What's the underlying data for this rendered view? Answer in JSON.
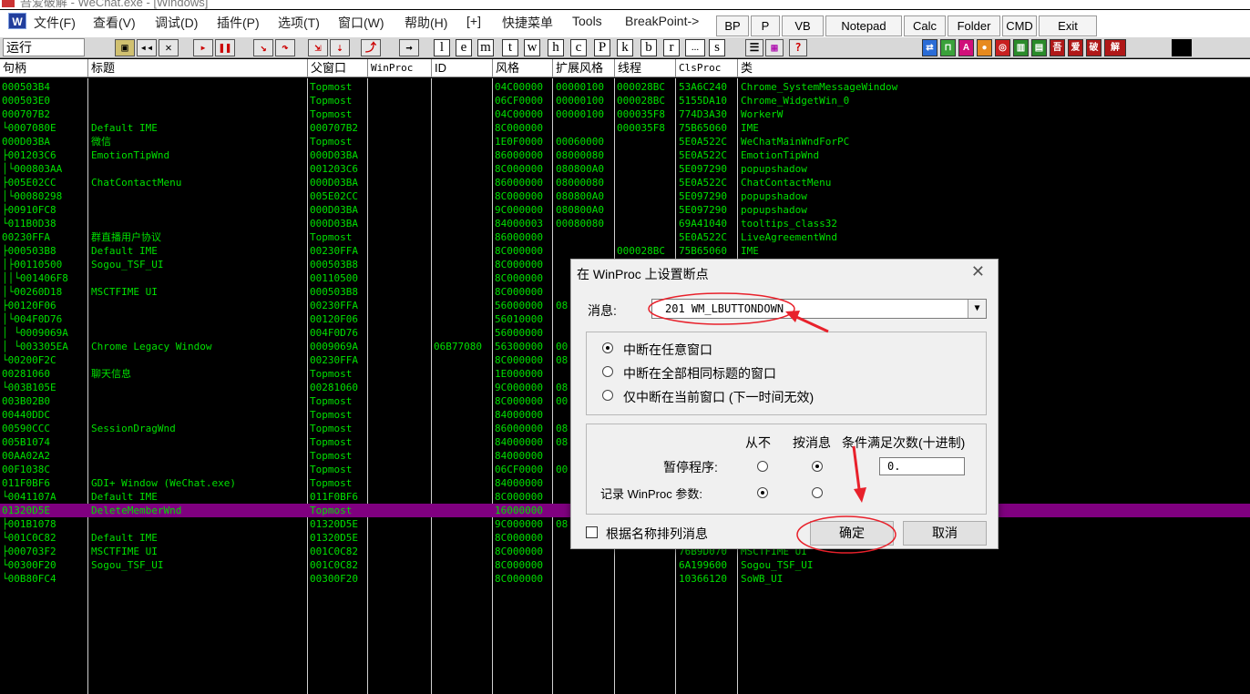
{
  "window": {
    "title": "吾爱破解 - WeChat.exe - [Windows]"
  },
  "menu": [
    "文件(F)",
    "查看(V)",
    "调试(D)",
    "插件(P)",
    "选项(T)",
    "窗口(W)",
    "帮助(H)",
    "[+]",
    "快捷菜单",
    "Tools",
    "BreakPoint->"
  ],
  "quick_buttons": [
    "BP",
    "P",
    "VB",
    "Notepad",
    "Calc",
    "Folder",
    "CMD",
    "Exit"
  ],
  "toolbar": {
    "status": "运行",
    "letters": [
      "l",
      "e",
      "m",
      "t",
      "w",
      "h",
      "c",
      "P",
      "k",
      "b",
      "r",
      "...",
      "s"
    ],
    "right_buttons": [
      "解",
      "破",
      "爱",
      "吾"
    ]
  },
  "columns": [
    "句柄",
    "标题",
    "父窗口",
    "WinProc",
    "ID",
    "风格",
    "扩展风格",
    "线程",
    "ClsProc",
    "类"
  ],
  "rows": [
    [
      "000503B4",
      "",
      "Topmost",
      "",
      "",
      "04C00000",
      "00000100",
      "000028BC",
      "53A6C240",
      "Chrome_SystemMessageWindow"
    ],
    [
      "000503E0",
      "",
      "Topmost",
      "",
      "",
      "06CF0000",
      "00000100",
      "000028BC",
      "5155DA10",
      "Chrome_WidgetWin_0"
    ],
    [
      "000707B2",
      "",
      "Topmost",
      "",
      "",
      "04C00000",
      "00000100",
      "000035F8",
      "774D3A30",
      "WorkerW"
    ],
    [
      "└0007080E",
      "Default IME",
      "000707B2",
      "",
      "",
      "8C000000",
      "",
      "000035F8",
      "75B65060",
      "IME"
    ],
    [
      "000D03BA",
      "微信",
      "Topmost",
      "",
      "",
      "1E0F0000",
      "00060000",
      "",
      "5E0A522C",
      "WeChatMainWndForPC"
    ],
    [
      "├001203C6",
      "EmotionTipWnd",
      "000D03BA",
      "",
      "",
      "86000000",
      "08000080",
      "",
      "5E0A522C",
      "EmotionTipWnd"
    ],
    [
      "│└000803AA",
      "",
      "001203C6",
      "",
      "",
      "8C000000",
      "080800A0",
      "",
      "5E097290",
      "popupshadow"
    ],
    [
      "├005E02CC",
      "ChatContactMenu",
      "000D03BA",
      "",
      "",
      "86000000",
      "08000080",
      "",
      "5E0A522C",
      "ChatContactMenu"
    ],
    [
      "│└00080298",
      "",
      "005E02CC",
      "",
      "",
      "8C000000",
      "080800A0",
      "",
      "5E097290",
      "popupshadow"
    ],
    [
      "├00910FC8",
      "",
      "000D03BA",
      "",
      "",
      "9C000000",
      "080800A0",
      "",
      "5E097290",
      "popupshadow"
    ],
    [
      "└011B0D38",
      "",
      "000D03BA",
      "",
      "",
      "84000003",
      "00080080",
      "",
      "69A41040",
      "tooltips_class32"
    ],
    [
      "00230FFA",
      "群直播用户协议",
      "Topmost",
      "",
      "",
      "86000000",
      "",
      "",
      "5E0A522C",
      "LiveAgreementWnd"
    ],
    [
      "├000503B8",
      "Default IME",
      "00230FFA",
      "",
      "",
      "8C000000",
      "",
      "000028BC",
      "75B65060",
      "IME"
    ],
    [
      "│├00110500",
      "Sogou_TSF_UI",
      "000503B8",
      "",
      "",
      "8C000000",
      "",
      "",
      "",
      ""
    ],
    [
      "││└001406F8",
      "",
      "00110500",
      "",
      "",
      "8C000000",
      "",
      "",
      "",
      ""
    ],
    [
      "│└00260D18",
      "MSCTFIME UI",
      "000503B8",
      "",
      "",
      "8C000000",
      "",
      "",
      "",
      ""
    ],
    [
      "├00120F06",
      "",
      "00230FFA",
      "",
      "",
      "56000000",
      "08",
      "",
      "",
      ""
    ],
    [
      "│└004F0D76",
      "",
      "00120F06",
      "",
      "",
      "56010000",
      "",
      "",
      "",
      ""
    ],
    [
      "│ └0009069A",
      "",
      "004F0D76",
      "",
      "",
      "56000000",
      "",
      "",
      "",
      ""
    ],
    [
      "│  └003305EA",
      "Chrome Legacy Window",
      "0009069A",
      "",
      "06B77080",
      "56300000",
      "00",
      "",
      "",
      ""
    ],
    [
      "└00200F2C",
      "",
      "00230FFA",
      "",
      "",
      "8C000000",
      "08",
      "",
      "",
      ""
    ],
    [
      "00281060",
      "聊天信息",
      "Topmost",
      "",
      "",
      "1E000000",
      "",
      "",
      "",
      ""
    ],
    [
      "└003B105E",
      "",
      "00281060",
      "",
      "",
      "9C000000",
      "08",
      "",
      "",
      ""
    ],
    [
      "003B02B0",
      "",
      "Topmost",
      "",
      "",
      "8C000000",
      "00",
      "",
      "",
      ""
    ],
    [
      "00440DDC",
      "",
      "Topmost",
      "",
      "",
      "84000000",
      "",
      "",
      "",
      ""
    ],
    [
      "00590CCC",
      "SessionDragWnd",
      "Topmost",
      "",
      "",
      "86000000",
      "08",
      "",
      "",
      ""
    ],
    [
      "005B1074",
      "",
      "Topmost",
      "",
      "",
      "84000000",
      "08",
      "",
      "",
      ""
    ],
    [
      "00AA02A2",
      "",
      "Topmost",
      "",
      "",
      "84000000",
      "",
      "",
      "",
      ""
    ],
    [
      "00F1038C",
      "",
      "Topmost",
      "",
      "",
      "06CF0000",
      "00",
      "",
      "",
      ""
    ],
    [
      "011F0BF6",
      "GDI+ Window (WeChat.exe)",
      "Topmost",
      "",
      "",
      "84000000",
      "",
      "",
      "",
      ""
    ],
    [
      "└0041107A",
      "Default IME",
      "011F0BF6",
      "",
      "",
      "8C000000",
      "",
      "",
      "",
      ""
    ],
    [
      "01320D5E",
      "DeleteMemberWnd",
      "Topmost",
      "",
      "",
      "16000000",
      "",
      "",
      "",
      ""
    ],
    [
      "├001B1078",
      "",
      "01320D5E",
      "",
      "",
      "9C000000",
      "08",
      "",
      "",
      ""
    ],
    [
      "└001C0C82",
      "Default IME",
      "01320D5E",
      "",
      "",
      "8C000000",
      "",
      "",
      "",
      ""
    ],
    [
      "├000703F2",
      "MSCTFIME UI",
      "001C0C82",
      "",
      "",
      "8C000000",
      "",
      "",
      "76B9D070",
      "MSCTFIME UI"
    ],
    [
      "└00300F20",
      "Sogou_TSF_UI",
      "001C0C82",
      "",
      "",
      "8C000000",
      "",
      "",
      "6A199600",
      "Sogou_TSF_UI"
    ],
    [
      "  └00B80FC4",
      "",
      "00300F20",
      "",
      "",
      "8C000000",
      "",
      "",
      "10366120",
      "SoWB_UI"
    ]
  ],
  "selected_row": 31,
  "dialog": {
    "title": "在 WinProc 上设置断点",
    "message_label": "消息:",
    "message_value": "201 WM_LBUTTONDOWN",
    "scope_options": [
      "中断在任意窗口",
      "中断在全部相同标题的窗口",
      "仅中断在当前窗口 (下一时间无效)"
    ],
    "scope_selected": 0,
    "col_never": "从不",
    "col_by_msg": "按消息",
    "col_condition": "条件满足次数(十进制)",
    "pause_label": "暂停程序:",
    "log_label": "记录 WinProc 参数:",
    "count_value": "0.",
    "sort_label": "根据名称排列消息",
    "ok": "确定",
    "cancel": "取消"
  },
  "colors": {
    "text": "#00e000",
    "selection": "#800080",
    "annotation": "#e8212b"
  }
}
